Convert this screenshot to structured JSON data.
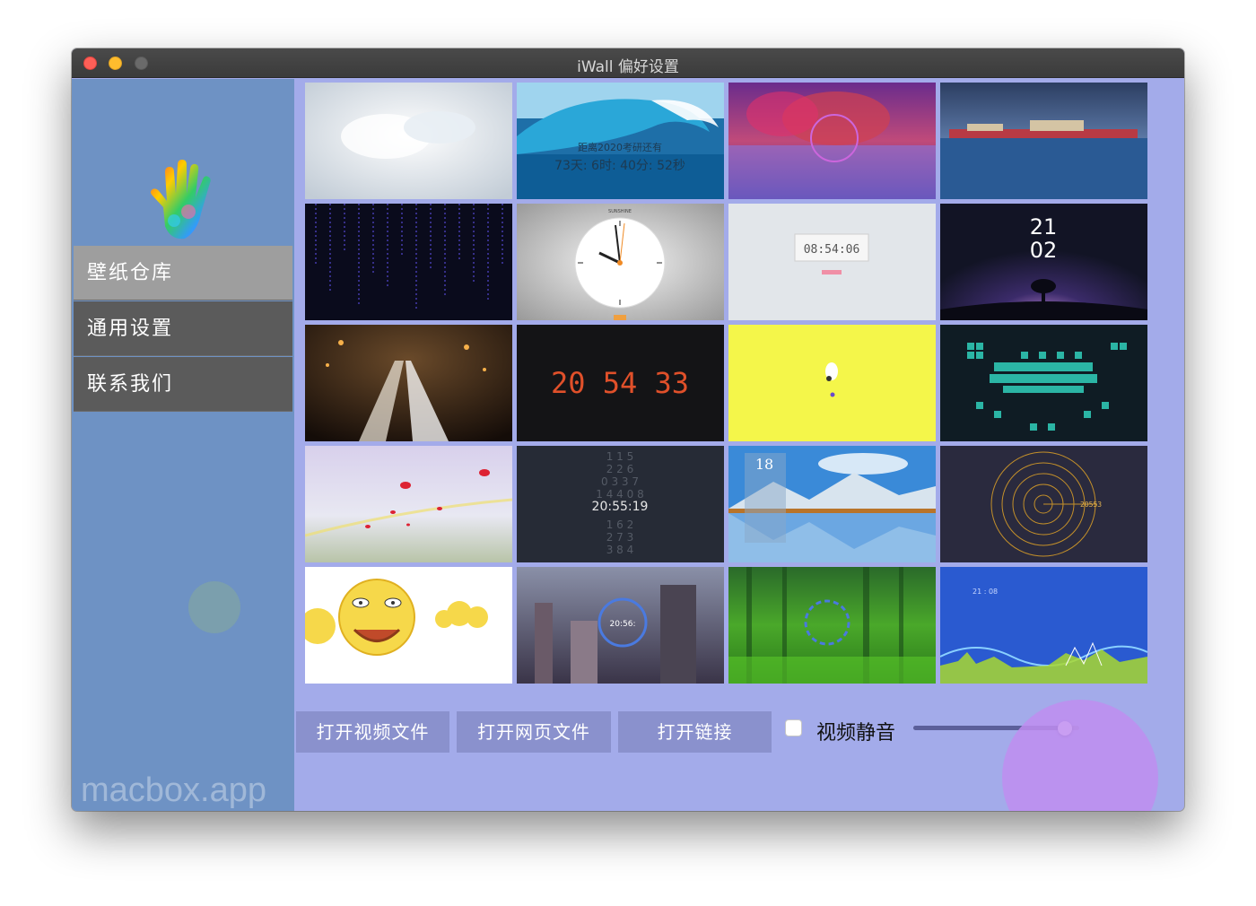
{
  "window": {
    "title": "iWall 偏好设置"
  },
  "sidebar": {
    "items": [
      {
        "label": "壁纸仓库",
        "active": true
      },
      {
        "label": "通用设置",
        "active": false
      },
      {
        "label": "联系我们",
        "active": false
      }
    ]
  },
  "wallpapers": [
    {
      "name": "clouds",
      "caption": ""
    },
    {
      "name": "wave-countdown",
      "caption": "距离2020考研还有",
      "caption2": "73天: 6时: 40分: 52秒"
    },
    {
      "name": "purple-tree-lake",
      "caption": ""
    },
    {
      "name": "harbor-city",
      "caption": ""
    },
    {
      "name": "matrix-rain",
      "caption": ""
    },
    {
      "name": "analog-clock",
      "caption": "SUNSHINE"
    },
    {
      "name": "digital-clock-light",
      "caption": "08:54:06"
    },
    {
      "name": "night-tree-clock",
      "caption": "21",
      "caption2": "02"
    },
    {
      "name": "light-trails",
      "caption": ""
    },
    {
      "name": "nixie-clock",
      "caption": "20 54 33"
    },
    {
      "name": "yellow-character",
      "caption": ""
    },
    {
      "name": "periodic-table",
      "caption": ""
    },
    {
      "name": "flying-leaves",
      "caption": ""
    },
    {
      "name": "number-column-clock",
      "caption": "20:55:19"
    },
    {
      "name": "mountain-lake",
      "caption": "18"
    },
    {
      "name": "radial-clock",
      "caption": "20553"
    },
    {
      "name": "emoji-faces",
      "caption": ""
    },
    {
      "name": "fantasy-city",
      "caption": "20:56:"
    },
    {
      "name": "green-forest",
      "caption": ""
    },
    {
      "name": "blue-audio-waves",
      "caption": "21 : 08"
    }
  ],
  "controls": {
    "open_video": "打开视频文件",
    "open_web": "打开网页文件",
    "open_link": "打开链接",
    "mute_label": "视频静音",
    "mute_checked": false,
    "volume": 0.95
  },
  "watermark": "macbox.app"
}
